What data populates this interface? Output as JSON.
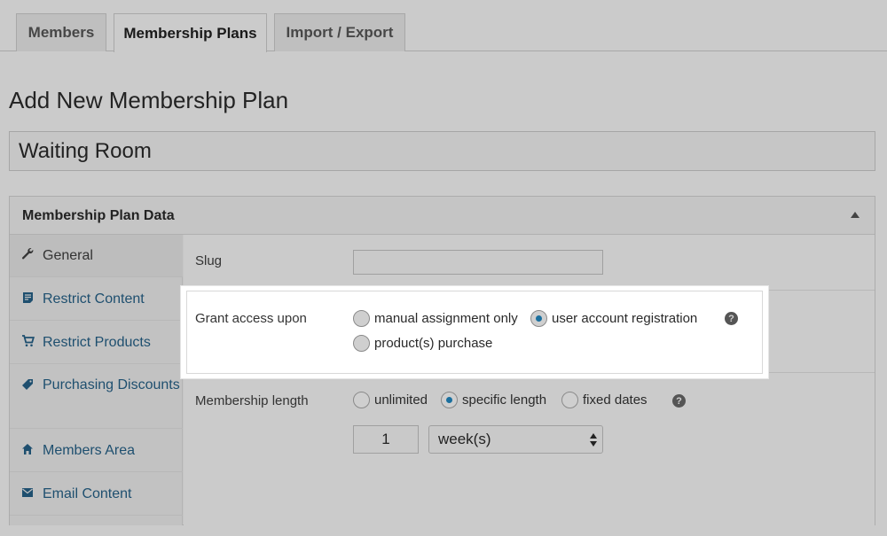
{
  "tabs": [
    {
      "label": "Members"
    },
    {
      "label": "Membership Plans"
    },
    {
      "label": "Import / Export"
    }
  ],
  "page_title": "Add New Membership Plan",
  "plan_name": "Waiting Room",
  "postbox": {
    "title": "Membership Plan Data",
    "toggle_icon": "triangle-up-icon"
  },
  "sidebar": {
    "items": [
      {
        "label": "General",
        "icon": "wrench-icon"
      },
      {
        "label": "Restrict Content",
        "icon": "document-icon"
      },
      {
        "label": "Restrict Products",
        "icon": "cart-icon"
      },
      {
        "label": "Purchasing Discounts",
        "icon": "tag-icon"
      },
      {
        "label": "Members Area",
        "icon": "home-icon"
      },
      {
        "label": "Email Content",
        "icon": "envelope-icon"
      }
    ]
  },
  "general": {
    "slug_label": "Slug",
    "slug_value": "",
    "grant_label": "Grant access upon",
    "grant_options": [
      {
        "label": "manual assignment only",
        "checked": false
      },
      {
        "label": "user account registration",
        "checked": true
      },
      {
        "label": "product(s) purchase",
        "checked": false
      }
    ],
    "length_label": "Membership length",
    "length_options": [
      {
        "label": "unlimited",
        "checked": false
      },
      {
        "label": "specific length",
        "checked": true
      },
      {
        "label": "fixed dates",
        "checked": false
      }
    ],
    "length_amount": "1",
    "length_unit": "week(s)",
    "help_glyph": "?"
  },
  "colors": {
    "link": "#1e4f6f",
    "radio_checked": "#1a6f9e",
    "highlight": "#ffffff"
  }
}
